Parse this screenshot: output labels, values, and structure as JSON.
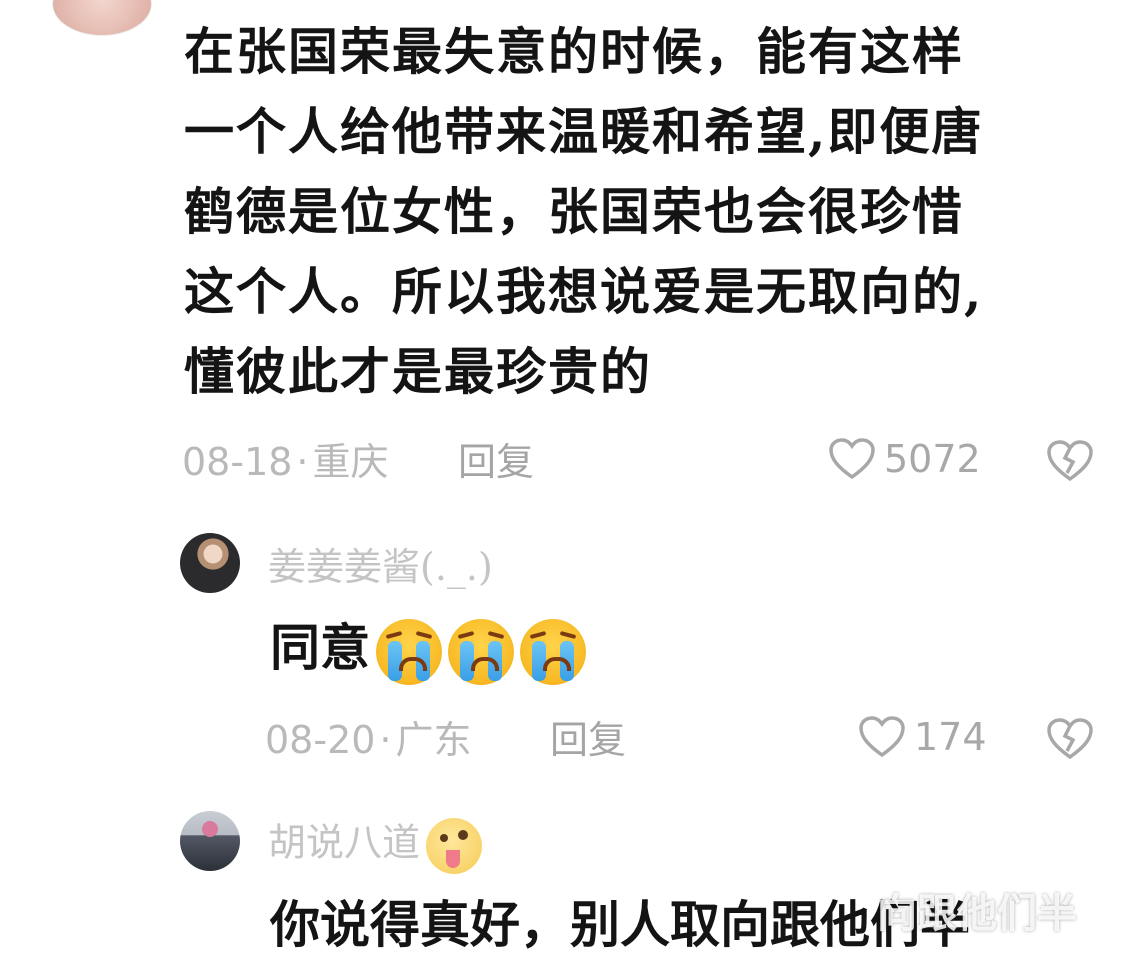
{
  "comment": {
    "text_lines": [
      "在张国荣最失意的时候，能有这样",
      "一个人给他带来温暖和希望,即便唐",
      "鹤德是位女性，张国荣也会很珍惜",
      "这个人。所以我想说爱是无取向的,",
      "懂彼此才是最珍贵的"
    ],
    "date": "08-18",
    "location": "重庆",
    "reply_label": "回复",
    "likes": "5072"
  },
  "replies": [
    {
      "username": "姜姜姜酱(._.)",
      "body": "同意",
      "emoji": "loudly-crying-face x3",
      "date": "08-20",
      "location": "广东",
      "reply_label": "回复",
      "likes": "174"
    },
    {
      "username": "胡说八道",
      "body": "你说得真好，别人取向跟他们半",
      "emoji": "zany-face",
      "watermark": "向跟他们半"
    }
  ],
  "icons": {
    "like": "heart-outline-icon",
    "dislike": "broken-heart-icon"
  },
  "colors": {
    "text": "#141414",
    "meta": "#b9b9b9",
    "username": "#c4c4c4",
    "icon": "#a8a8a8"
  }
}
